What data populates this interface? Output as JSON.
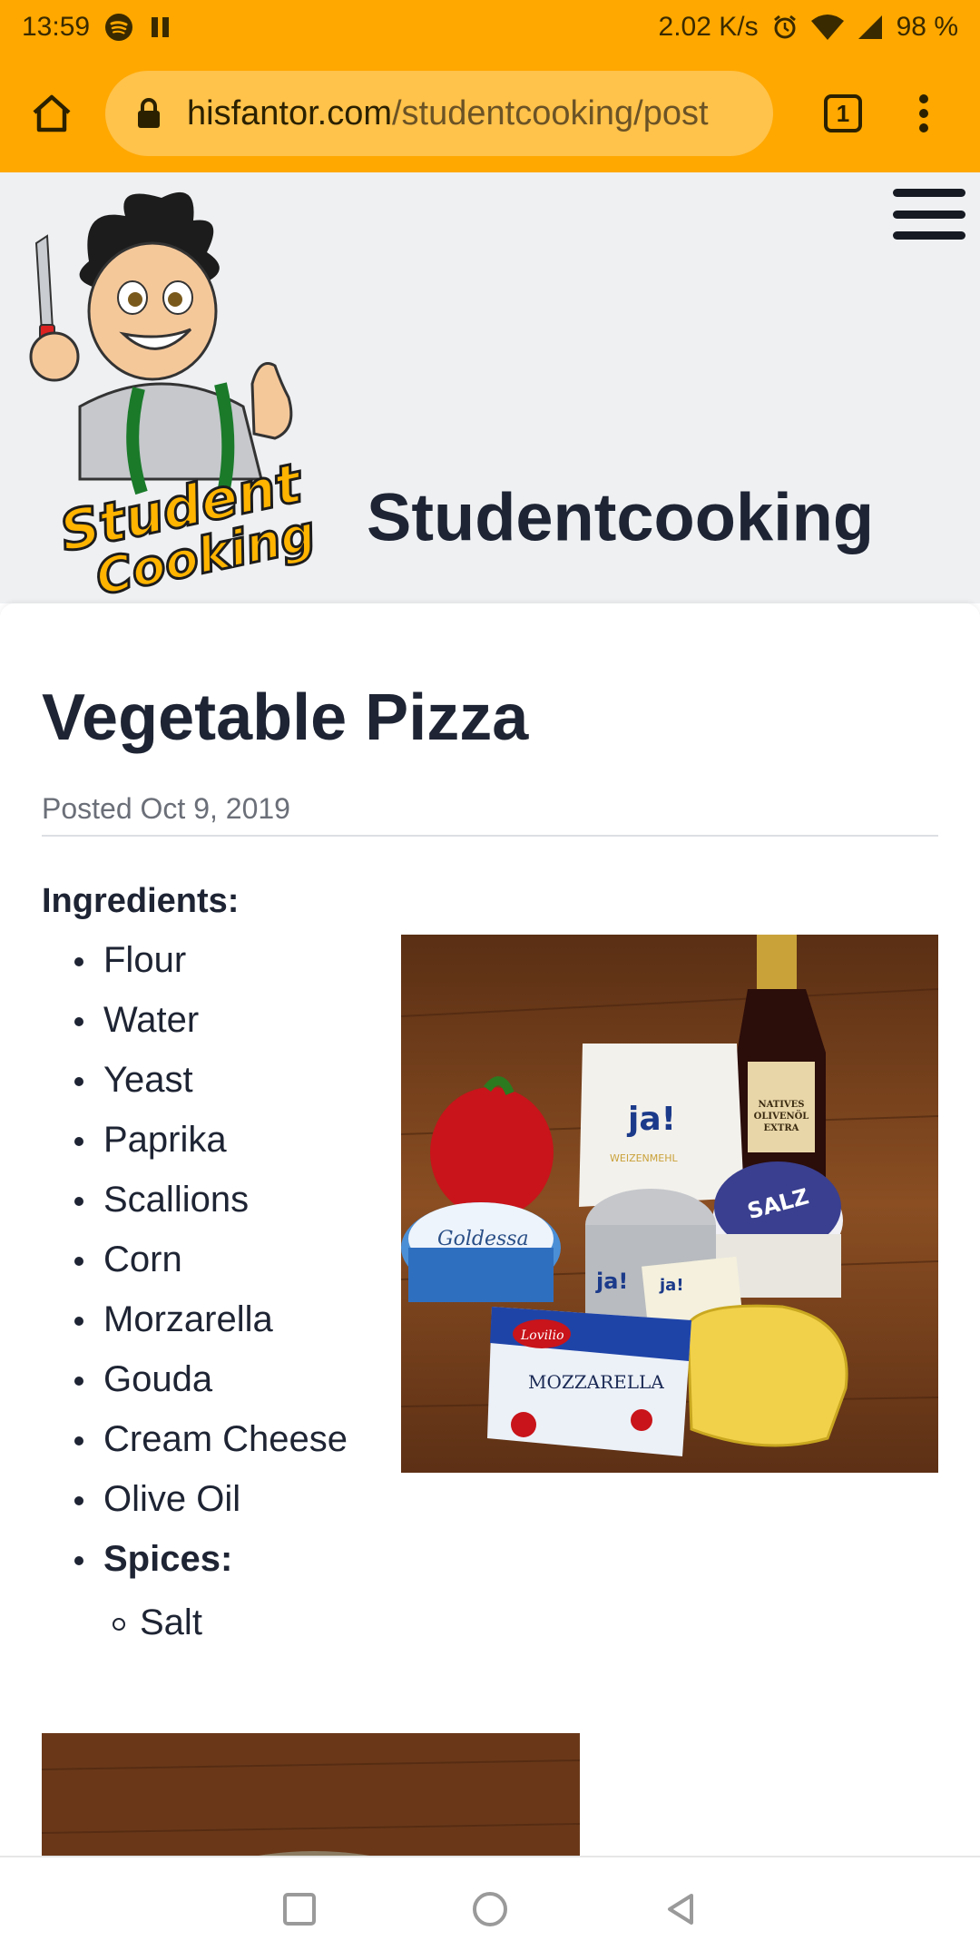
{
  "status_bar": {
    "time": "13:59",
    "network_speed": "2.02 K/s",
    "battery": "98 %",
    "icons": [
      "spotify-icon",
      "pause-icon",
      "alarm-icon",
      "wifi-icon",
      "signal-icon"
    ]
  },
  "browser": {
    "url_domain": "hisfantor.com",
    "url_path": "/studentcooking/post",
    "tab_count": "1",
    "accent_color": "#ffa800"
  },
  "site": {
    "title": "Studentcooking",
    "logo_text_line1": "Student",
    "logo_text_line2": "Cooking"
  },
  "post": {
    "title": "Vegetable Pizza",
    "date": "Posted Oct 9, 2019",
    "ingredients_heading": "Ingredients:",
    "ingredients": [
      "Flour",
      "Water",
      "Yeast",
      "Paprika",
      "Scallions",
      "Corn",
      "Morzarella",
      "Gouda",
      "Cream Cheese",
      "Olive Oil",
      "Spices:"
    ],
    "spices": [
      "Salt"
    ],
    "photo_labels": {
      "flour_brand": "ja!",
      "flour_type": "WEIZENMEHL",
      "oil_line1": "NATIVES",
      "oil_line2": "OLIVENÖL",
      "oil_line3": "EXTRA",
      "cheese_brand": "Goldessa",
      "mozzarella": "MOZZARELLA",
      "mozz_brand": "Lovilio",
      "salt": "SALZ",
      "can_brand": "ja!",
      "yeast_brand": "ja!"
    }
  }
}
